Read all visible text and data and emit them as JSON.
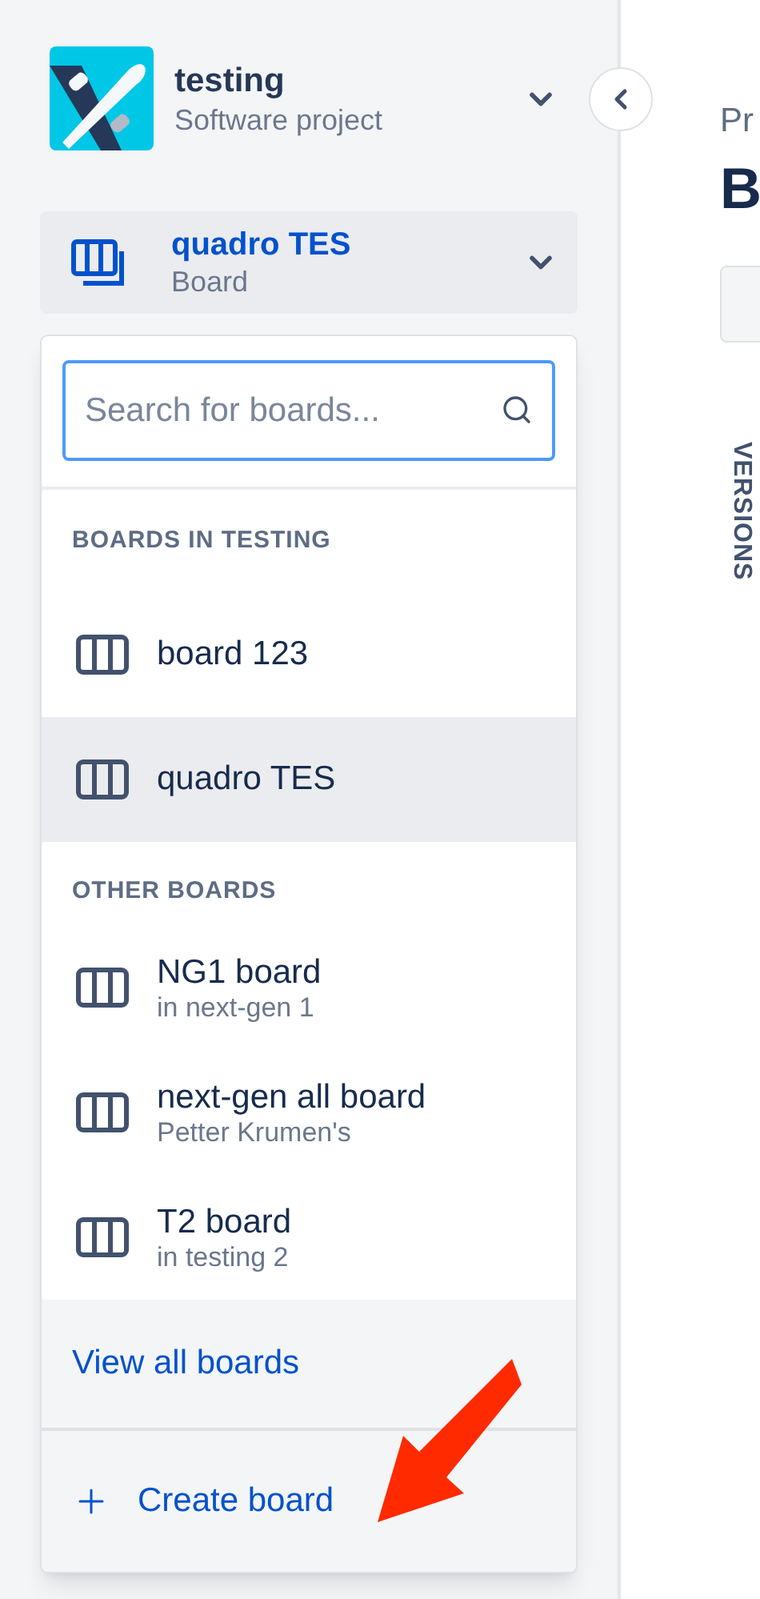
{
  "project": {
    "name": "testing",
    "type": "Software project"
  },
  "board_selector": {
    "name": "quadro TES",
    "type": "Board",
    "expanded": true
  },
  "dropdown": {
    "search": {
      "placeholder": "Search for boards..."
    },
    "sections": [
      {
        "heading": "BOARDS IN TESTING",
        "items": [
          {
            "name": "board 123",
            "selected": false
          },
          {
            "name": "quadro TES",
            "selected": true
          }
        ]
      },
      {
        "heading": "OTHER BOARDS",
        "items": [
          {
            "name": "NG1 board",
            "subtitle": "in next-gen 1",
            "selected": false
          },
          {
            "name": "next-gen all board",
            "subtitle": "Petter Krumen's",
            "selected": false
          },
          {
            "name": "T2 board",
            "subtitle": "in testing 2",
            "selected": false
          }
        ]
      }
    ],
    "view_all": "View all boards",
    "create": "Create board"
  },
  "main": {
    "breadcrumb": "Pr",
    "title": "B",
    "side_tab": "VERSIONS"
  }
}
